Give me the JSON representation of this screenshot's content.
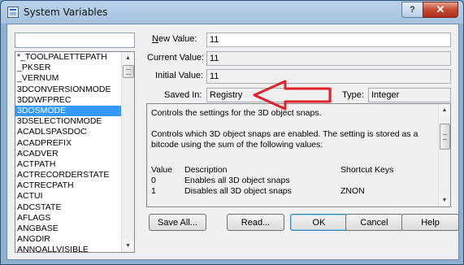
{
  "window": {
    "title": "System Variables"
  },
  "caption": {
    "help": "?",
    "close": "✕"
  },
  "list": {
    "items": [
      "*_TOOLPALETTEPATH",
      "_PKSER",
      "_VERNUM",
      "3DCONVERSIONMODE",
      "3DDWFPREC",
      "3DOSMODE",
      "3DSELECTIONMODE",
      "ACADLSPASDOC",
      "ACADPREFIX",
      "ACADVER",
      "ACTPATH",
      "ACTRECORDERSTATE",
      "ACTRECPATH",
      "ACTUI",
      "ADCSTATE",
      "AFLAGS",
      "ANGBASE",
      "ANGDIR",
      "ANNOALLVISIBLE"
    ],
    "selected": "3DOSMODE"
  },
  "fields": {
    "new_value_label": "New Value:",
    "new_value": "11",
    "current_value_label": "Current Value:",
    "current_value": "11",
    "initial_value_label": "Initial Value:",
    "initial_value": "11",
    "saved_in_label": "Saved In:",
    "saved_in": "Registry",
    "type_label": "Type:",
    "type": "Integer"
  },
  "description": {
    "line1": "Controls the settings for the 3D object snaps.",
    "line2": "Controls which 3D object snaps are enabled. The setting is stored as a bitcode using the sum of the following values:",
    "headers": {
      "value": "Value",
      "description": "Description",
      "shortcut": "Shortcut Keys"
    },
    "rows": [
      {
        "value": "0",
        "description": "Enables all 3D object snaps",
        "shortcut": ""
      },
      {
        "value": "1",
        "description": "Disables all 3D object snaps",
        "shortcut": "ZNON"
      }
    ]
  },
  "buttons": {
    "save_all": "Save All...",
    "read": "Read...",
    "ok": "OK",
    "cancel": "Cancel",
    "help": "Help"
  },
  "annotation": {
    "arrow_color": "#e4202a"
  }
}
